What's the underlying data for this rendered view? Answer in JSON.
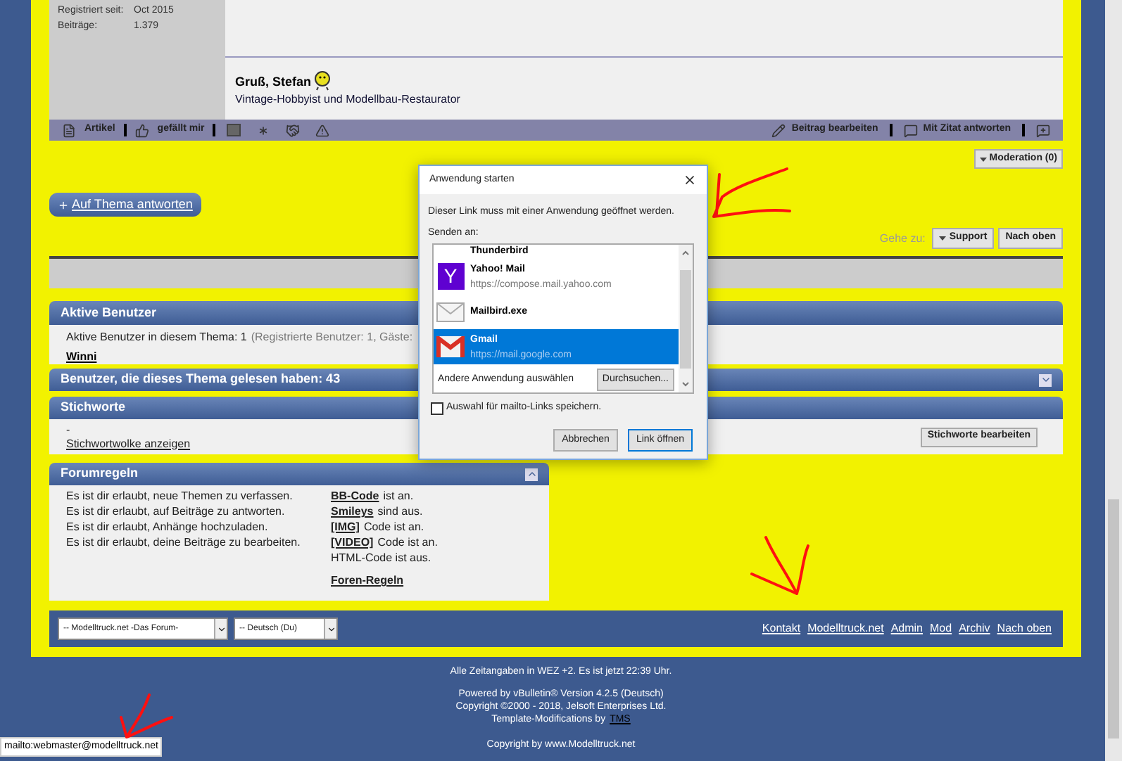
{
  "post": {
    "user_info": [
      {
        "label": "Registriert seit:",
        "value": "Oct 2015"
      },
      {
        "label": "Beiträge:",
        "value": "1.379"
      }
    ],
    "signature": {
      "greeting": "Gruß, Stefan",
      "tagline": "Vintage-Hobbyist und Modellbau-Restaurator"
    },
    "toolbar_left": [
      {
        "kind": "article",
        "label": "Artikel"
      },
      {
        "kind": "like",
        "label": "gefällt mir"
      }
    ],
    "toolbar_right": [
      {
        "kind": "edit",
        "label": "Beitrag bearbeiten"
      },
      {
        "kind": "quote",
        "label": "Mit Zitat antworten"
      },
      {
        "kind": "multiquote"
      }
    ]
  },
  "moderation_button": "Moderation (0)",
  "reply_button": "Auf Thema antworten",
  "navigation": {
    "label": "Gehe zu:",
    "forum_button": "Support",
    "top_button": "Nach oben"
  },
  "active_users": {
    "title": "Aktive Benutzer",
    "summary": "Aktive Benutzer in diesem Thema: 1",
    "detail": "(Registrierte Benutzer: 1, Gäste:",
    "users": [
      "Winni"
    ]
  },
  "readers": {
    "title": "Benutzer, die dieses Thema gelesen haben: 43",
    "expanded": false
  },
  "tags": {
    "title": "Stichworte",
    "value": "-",
    "cloud_link": "Stichwortwolke anzeigen",
    "edit_button": "Stichworte bearbeiten"
  },
  "forum_rules": {
    "title": "Forumregeln",
    "expanded": true,
    "permissions": [
      "Es ist dir erlaubt, neue Themen zu verfassen.",
      "Es ist dir erlaubt, auf Beiträge zu antworten.",
      "Es ist dir erlaubt, Anhänge hochzuladen.",
      "Es ist dir erlaubt, deine Beiträge zu bearbeiten."
    ],
    "settings": [
      {
        "link": "BB-Code",
        "text": "ist an."
      },
      {
        "link": "Smileys",
        "text": "sind aus."
      },
      {
        "link": "[IMG]",
        "text": "Code ist an."
      },
      {
        "link": "[VIDEO]",
        "text": "Code ist an."
      },
      {
        "text": "HTML-Code ist aus."
      }
    ],
    "rules_link": "Foren-Regeln"
  },
  "footer_bar": {
    "selects": [
      "-- Modelltruck.net -Das Forum-",
      "-- Deutsch (Du)"
    ],
    "links": [
      "Kontakt",
      "Modelltruck.net",
      "Admin",
      "Mod",
      "Archiv",
      "Nach oben"
    ]
  },
  "page_footer": {
    "time_note": "Alle Zeitangaben in WEZ +2. Es ist jetzt 22:39 Uhr.",
    "powered": "Powered by vBulletin® Version 4.2.5 (Deutsch)",
    "copyright": "Copyright ©2000 - 2018, Jelsoft Enterprises Ltd.",
    "template_prefix": "Template-Modifications by",
    "template_link": "TMS",
    "site_copyright": "Copyright by www.Modelltruck.net"
  },
  "status_bar": "mailto:webmaster@modelltruck.net",
  "dialog": {
    "title": "Anwendung starten",
    "message": "Dieser Link muss mit einer Anwendung geöffnet werden.",
    "list_label": "Senden an:",
    "apps": [
      {
        "kind": "cut",
        "name": "Thunderbird",
        "selected": false
      },
      {
        "kind": "letter",
        "logo_letter": "Y",
        "name": "Yahoo! Mail",
        "url": "https://compose.mail.yahoo.com",
        "selected": false
      },
      {
        "kind": "envelope",
        "name": "Mailbird.exe",
        "selected": false
      },
      {
        "kind": "mail-m",
        "name": "Gmail",
        "url": "https://mail.google.com",
        "selected": true
      }
    ],
    "other_label": "Andere Anwendung auswählen",
    "browse_button": "Durchsuchen...",
    "remember": {
      "label": "Auswahl für mailto-Links speichern.",
      "checked": false
    },
    "buttons": [
      {
        "label": "Abbrechen",
        "default": false
      },
      {
        "label": "Link öffnen",
        "default": true
      }
    ]
  }
}
